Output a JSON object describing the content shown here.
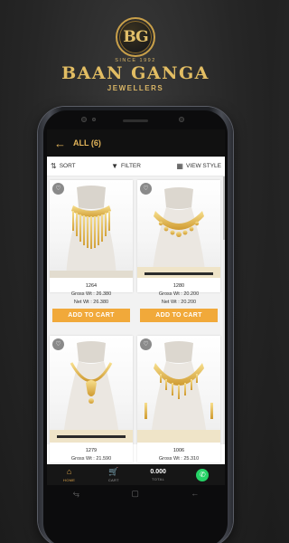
{
  "brand": {
    "monogram": "BG",
    "since": "SINCE 1992",
    "name": "BAAN GANGA",
    "subtitle": "JEWELLERS"
  },
  "appbar": {
    "back_icon": "arrow-left-icon",
    "title": "ALL (6)"
  },
  "toolbar": {
    "sort": "SORT",
    "filter": "FILTER",
    "view_style": "VIEW STYLE"
  },
  "products": [
    {
      "code": "1264",
      "gross": "Gross Wt : 26.380",
      "net": "Net Wt : 26.380",
      "button": "ADD TO CART"
    },
    {
      "code": "1280",
      "gross": "Gross Wt : 20.200",
      "net": "Net Wt : 20.200",
      "button": "ADD TO CART"
    },
    {
      "code": "1279",
      "gross": "Gross Wt : 21.590"
    },
    {
      "code": "1006",
      "gross": "Gross Wt : 25.310"
    }
  ],
  "bottom_nav": {
    "home": "HOME",
    "cart": "CART",
    "total_value": "0.000",
    "total_label": "TOTAL"
  },
  "colors": {
    "accent": "#f1a93a",
    "gold": "#e2bd63",
    "whatsapp": "#25d366"
  }
}
